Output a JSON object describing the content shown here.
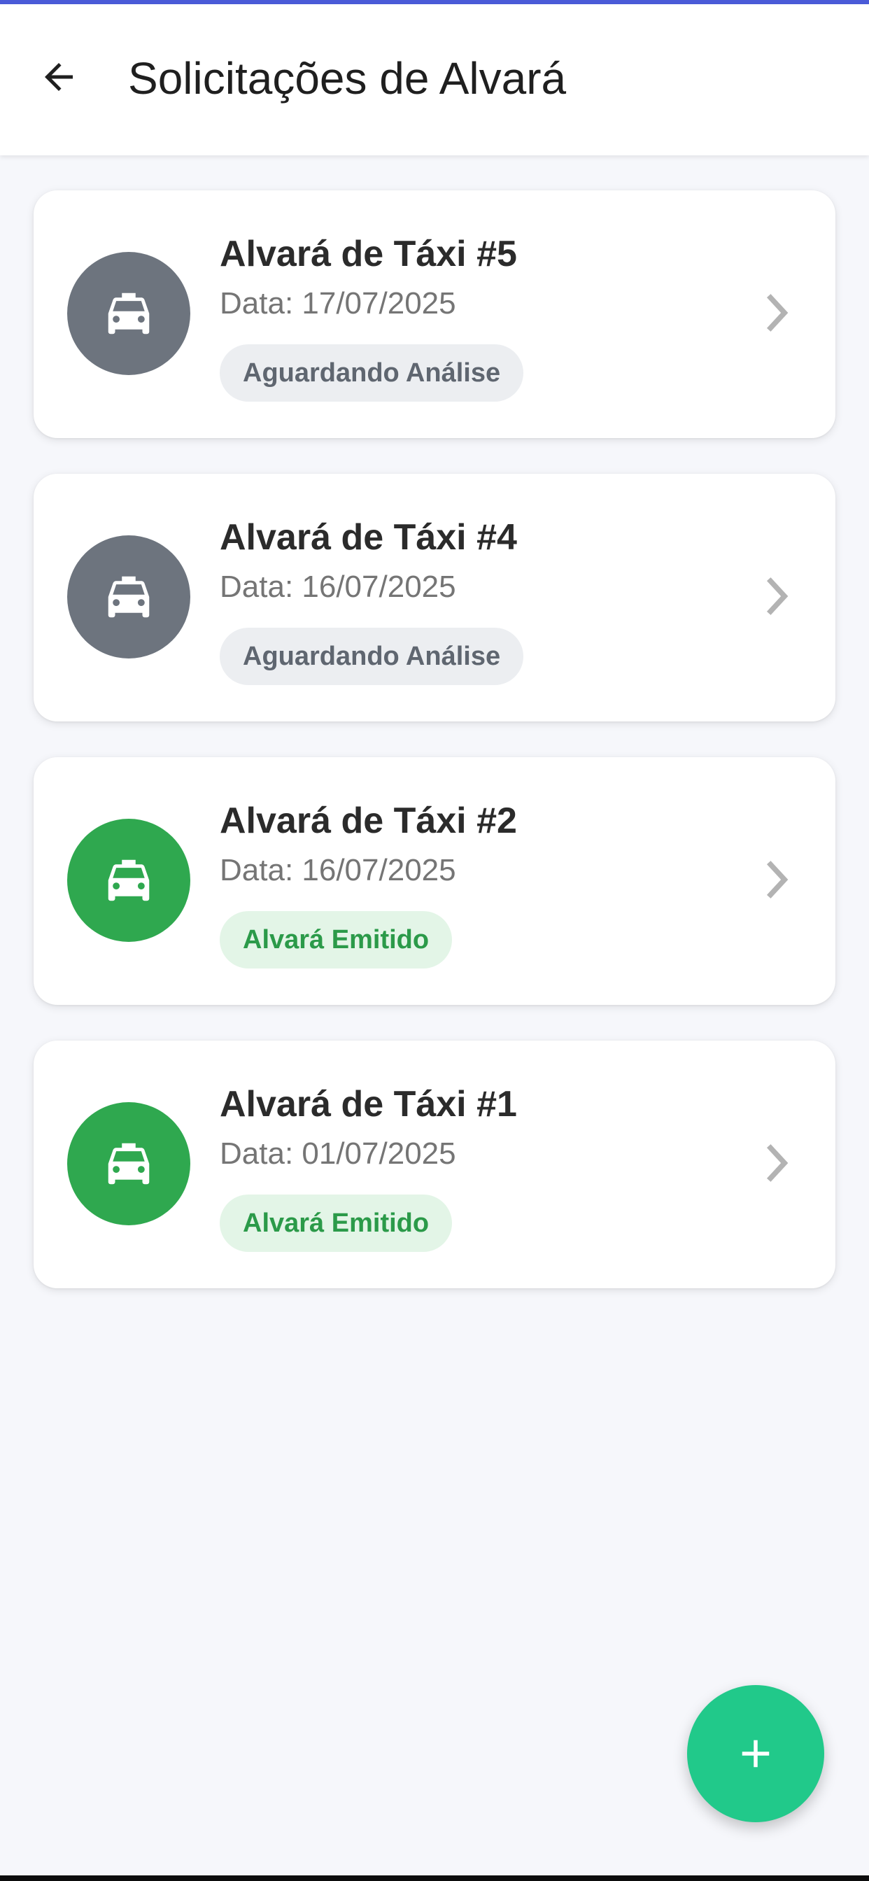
{
  "header": {
    "title": "Solicitações de Alvará",
    "back_icon": "arrow-left-icon"
  },
  "colors": {
    "pending": "#6d747e",
    "issued": "#2fa84f",
    "pending_badge_bg": "#eceef1",
    "pending_badge_text": "#5f6670",
    "issued_badge_bg": "#e3f5e7",
    "issued_badge_text": "#2b9a49",
    "fab": "#21c98a"
  },
  "requests": [
    {
      "title": "Alvará de Táxi #5",
      "date": "Data: 17/07/2025",
      "status": "Aguardando Análise",
      "status_kind": "pending",
      "icon": "taxi-icon"
    },
    {
      "title": "Alvará de Táxi #4",
      "date": "Data: 16/07/2025",
      "status": "Aguardando Análise",
      "status_kind": "pending",
      "icon": "taxi-icon"
    },
    {
      "title": "Alvará de Táxi #2",
      "date": "Data: 16/07/2025",
      "status": "Alvará Emitido",
      "status_kind": "issued",
      "icon": "taxi-icon"
    },
    {
      "title": "Alvará de Táxi #1",
      "date": "Data: 01/07/2025",
      "status": "Alvará Emitido",
      "status_kind": "issued",
      "icon": "taxi-icon"
    }
  ],
  "fab": {
    "icon": "plus-icon"
  }
}
